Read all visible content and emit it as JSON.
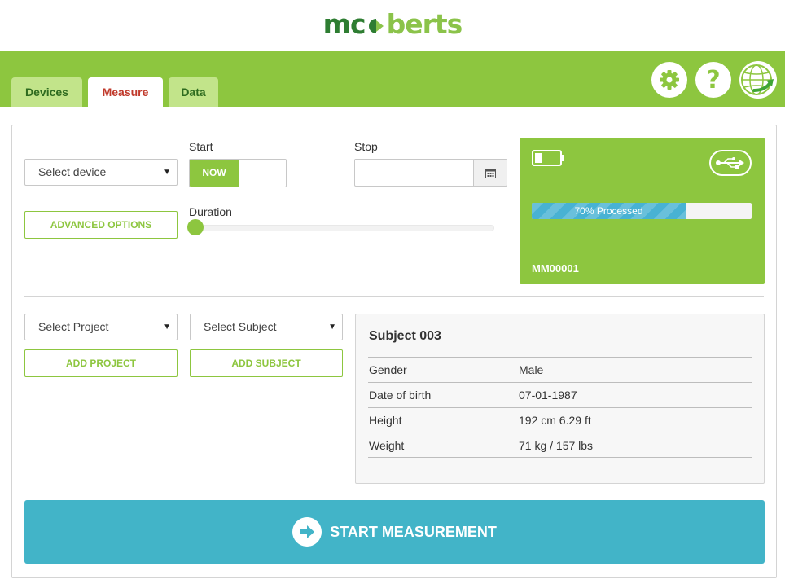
{
  "brand": {
    "logo_part1": "mc",
    "logo_part2": "berts",
    "color_dark": "#2e7d32",
    "color_light": "#8bc34a"
  },
  "nav": {
    "tabs": [
      {
        "label": "Devices",
        "active": false
      },
      {
        "label": "Measure",
        "active": true
      },
      {
        "label": "Data",
        "active": false
      }
    ],
    "accent": "#8dc63f",
    "icons": [
      "gear-icon",
      "help-icon",
      "globe-icon"
    ],
    "help_glyph": "?"
  },
  "measure": {
    "device_select": {
      "value": "Select device"
    },
    "start_label": "Start",
    "start_toggle": {
      "on_label": "NOW"
    },
    "stop_label": "Stop",
    "stop_value": "",
    "advanced_options_label": "ADVANCED OPTIONS",
    "duration_label": "Duration",
    "duration_value": 0
  },
  "device_card": {
    "progress_percent": 70,
    "progress_text": "70% Processed",
    "device_id": "MM00001",
    "icons": [
      "battery-icon",
      "usb-icon"
    ]
  },
  "project": {
    "project_select": {
      "value": "Select Project"
    },
    "subject_select": {
      "value": "Select Subject"
    },
    "add_project_label": "ADD PROJECT",
    "add_subject_label": "ADD SUBJECT"
  },
  "subject": {
    "title": "Subject 003",
    "rows": [
      {
        "key": "Gender",
        "value": "Male"
      },
      {
        "key": "Date of birth",
        "value": "07-01-1987"
      },
      {
        "key": "Height",
        "value": "192 cm 6.29 ft"
      },
      {
        "key": "Weight",
        "value": "71 kg / 157 lbs"
      }
    ]
  },
  "start_measurement": {
    "label": "START MEASUREMENT",
    "color": "#42b4c8"
  }
}
